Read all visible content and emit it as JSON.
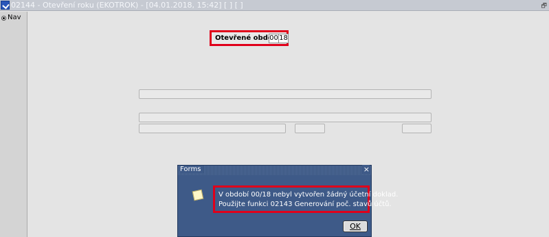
{
  "window": {
    "title": "02144 - Otevření roku (EKOTROK) - [04.01.2018, 15:42]  [ ]  [ ]"
  },
  "sidebar": {
    "nav_label": "Nav"
  },
  "form": {
    "period_label": "Otevřené období",
    "period_month": "00",
    "period_year": "18"
  },
  "dialog": {
    "title": "Forms",
    "close": "×",
    "message_line1": "V období 00/18 nebyl vytvořen žádný účetní doklad.",
    "message_line2": "Použijte funkci 02143 Generování poč. stavů účtů.",
    "ok_label": "OK"
  },
  "colors": {
    "highlight": "#e0001a",
    "dialog_bg": "#3e5a88"
  }
}
